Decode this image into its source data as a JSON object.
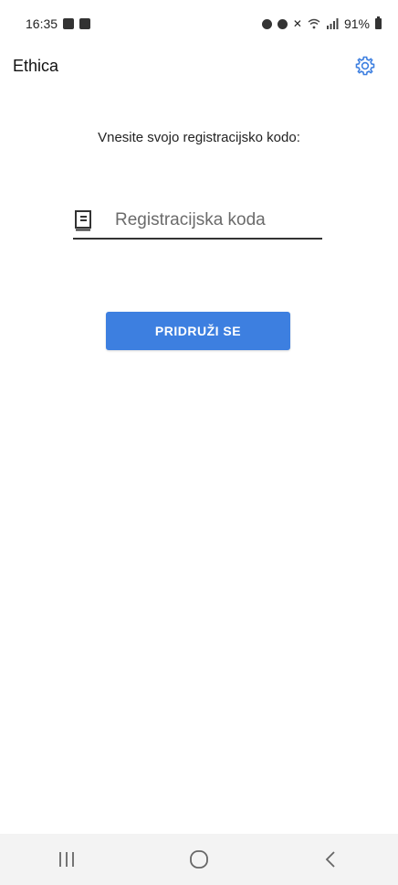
{
  "status_bar": {
    "time": "16:35",
    "battery": "91%",
    "left_icons": [
      "image-icon",
      "check-box-icon"
    ],
    "right_icons": [
      "alarm-icon",
      "settings-notification-icon",
      "mute-icon",
      "wifi-icon",
      "signal-icon",
      "battery-icon"
    ]
  },
  "app_bar": {
    "title": "Ethica",
    "settings_icon": "gear-icon"
  },
  "main": {
    "prompt": "Vnesite svojo registracijsko kodo:",
    "code_input": {
      "placeholder": "Registracijska koda",
      "value": "",
      "icon": "book-icon"
    },
    "join_button_label": "PRIDRUŽI SE",
    "accent_color": "#3d7fe0"
  },
  "nav_bar": {
    "recents_icon": "recent-apps-icon",
    "home_icon": "home-icon",
    "back_icon": "back-icon"
  }
}
